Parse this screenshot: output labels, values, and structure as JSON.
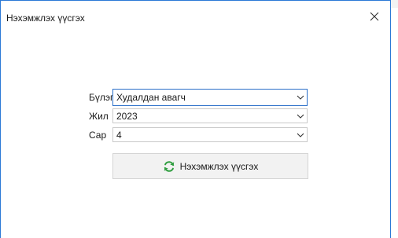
{
  "window": {
    "title": "Нэхэмжлэх үүсгэх",
    "close_icon": "close-icon",
    "border_color": "#2b79d6"
  },
  "form": {
    "fields": [
      {
        "label": "Бүлэг",
        "value": "Худалдан авагч"
      },
      {
        "label": "Жил",
        "value": "2023"
      },
      {
        "label": "Сар",
        "value": "4"
      }
    ],
    "generate_button": {
      "label": "Нэхэмжлэх үүсгэх",
      "icon": "refresh-icon",
      "icon_color": "#2e9d3e"
    }
  }
}
